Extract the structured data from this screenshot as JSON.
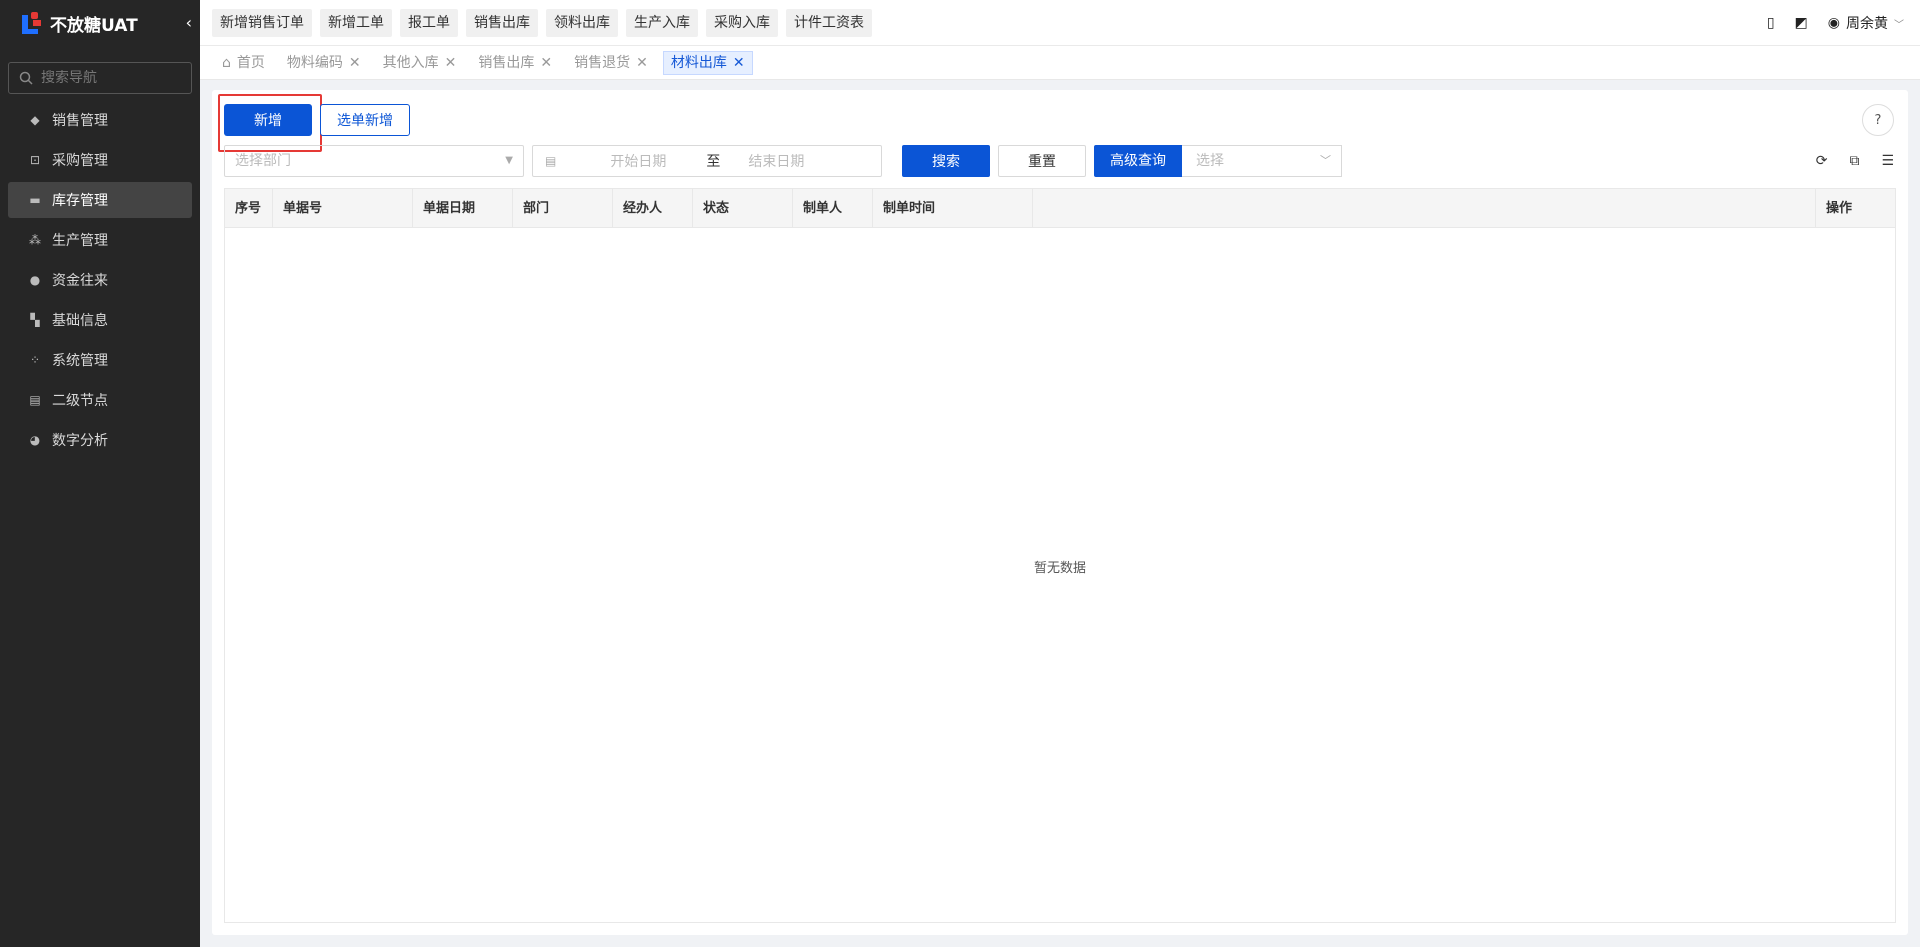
{
  "brand": {
    "title": "不放糖UAT"
  },
  "sidebar": {
    "search_placeholder": "搜索导航",
    "items": [
      {
        "label": "销售管理",
        "icon": "tag-icon"
      },
      {
        "label": "采购管理",
        "icon": "cart-icon"
      },
      {
        "label": "库存管理",
        "icon": "archive-icon",
        "active": true
      },
      {
        "label": "生产管理",
        "icon": "nodes-icon"
      },
      {
        "label": "资金往来",
        "icon": "money-icon"
      },
      {
        "label": "基础信息",
        "icon": "layout-icon"
      },
      {
        "label": "系统管理",
        "icon": "apps-icon"
      },
      {
        "label": "二级节点",
        "icon": "list-icon"
      },
      {
        "label": "数字分析",
        "icon": "pie-icon"
      }
    ]
  },
  "topbar": {
    "quick": [
      "新增销售订单",
      "新增工单",
      "报工单",
      "销售出库",
      "领料出库",
      "生产入库",
      "采购入库",
      "计件工资表"
    ],
    "user": "周余黄"
  },
  "tabs": [
    {
      "label": "首页",
      "home": true
    },
    {
      "label": "物料编码"
    },
    {
      "label": "其他入库"
    },
    {
      "label": "销售出库"
    },
    {
      "label": "销售退货"
    },
    {
      "label": "材料出库",
      "active": true
    }
  ],
  "toolbar": {
    "add_label": "新增",
    "select_add_label": "选单新增"
  },
  "filters": {
    "dept_placeholder": "选择部门",
    "start_placeholder": "开始日期",
    "range_sep": "至",
    "end_placeholder": "结束日期",
    "search_label": "搜索",
    "reset_label": "重置",
    "advanced_label": "高级查询",
    "advanced_placeholder": "选择"
  },
  "table": {
    "columns": [
      "序号",
      "单据号",
      "单据日期",
      "部门",
      "经办人",
      "状态",
      "制单人",
      "制单时间"
    ],
    "op_column": "操作",
    "empty_text": "暂无数据"
  },
  "colors": {
    "primary": "#0b55d6",
    "sidebar": "#262626",
    "highlight": "#e53935"
  }
}
